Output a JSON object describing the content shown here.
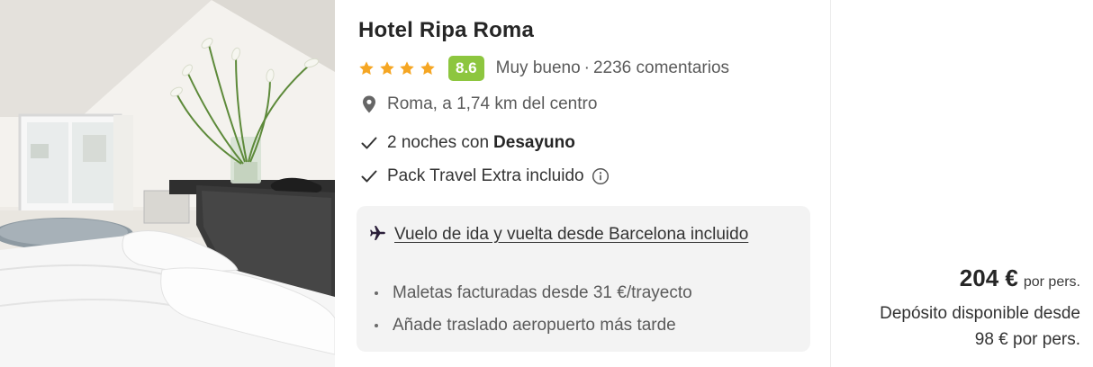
{
  "hotel": {
    "name": "Hotel Ripa Roma",
    "stars": 4,
    "score": "8.6",
    "rating_label": "Muy bueno",
    "separator": "·",
    "reviews": "2236 comentarios",
    "location": "Roma, a 1,74 km del centro"
  },
  "features": {
    "nights_text": "2 noches con",
    "board": "Desayuno",
    "pack": "Pack Travel Extra incluido"
  },
  "flight": {
    "link": "Vuelo de ida y vuelta desde Barcelona incluido",
    "bullets": [
      "Maletas facturadas desde 31 €/trayecto",
      "Añade traslado aeropuerto más tarde"
    ]
  },
  "price": {
    "amount": "204 €",
    "unit": "por pers.",
    "deposit": "Depósito disponible desde 98 € por pers."
  },
  "icons": {
    "star": "star-icon",
    "pin": "location-pin-icon",
    "check": "check-icon",
    "info": "info-icon",
    "plane": "plane-icon"
  },
  "colors": {
    "star": "#f5a623",
    "score_bg": "#8dc63f",
    "box_bg": "#f3f3f3",
    "plane": "#2b1f3a"
  }
}
